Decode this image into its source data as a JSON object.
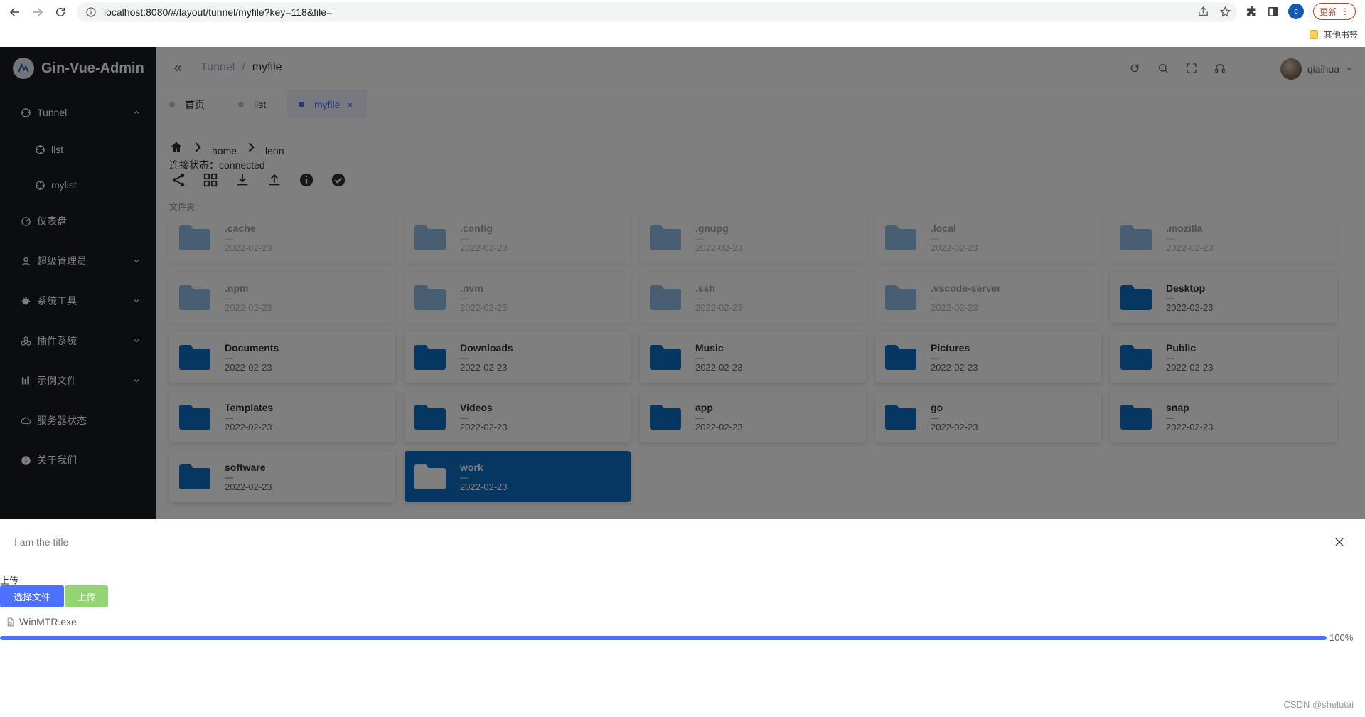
{
  "browser": {
    "url": "localhost:8080/#/layout/tunnel/myfile?key=118&file=",
    "profile_initial": "c",
    "update_label": "更新",
    "bookmark_other": "其他书签"
  },
  "sidebar": {
    "brand": "Gin-Vue-Admin",
    "items": [
      {
        "label": "Tunnel",
        "icon": "compass-icon"
      },
      {
        "label": "list",
        "icon": "compass-icon"
      },
      {
        "label": "mylist",
        "icon": "compass-icon"
      },
      {
        "label": "仪表盘",
        "icon": "dashboard-icon"
      },
      {
        "label": "超级管理员",
        "icon": "user-icon"
      },
      {
        "label": "系统工具",
        "icon": "gear-icon"
      },
      {
        "label": "插件系统",
        "icon": "plugin-icon"
      },
      {
        "label": "示例文件",
        "icon": "chart-icon"
      },
      {
        "label": "服务器状态",
        "icon": "cloud-icon"
      },
      {
        "label": "关于我们",
        "icon": "info-icon"
      }
    ]
  },
  "header": {
    "breadcrumb": [
      "Tunnel",
      "/",
      "myfile"
    ],
    "username": "qiaihua"
  },
  "tabs": [
    {
      "label": "首页",
      "active": false
    },
    {
      "label": "list",
      "active": false
    },
    {
      "label": "myfile",
      "active": true,
      "close": "×"
    }
  ],
  "filebrowser": {
    "path": [
      "home",
      "leon"
    ],
    "status": "连接状态：connected",
    "folders_label": "文件夹:",
    "folders": [
      {
        "name": ".cache",
        "size": "—",
        "date": "2022-02-23",
        "hidden": true
      },
      {
        "name": ".config",
        "size": "—",
        "date": "2022-02-23",
        "hidden": true
      },
      {
        "name": ".gnupg",
        "size": "—",
        "date": "2022-02-23",
        "hidden": true
      },
      {
        "name": ".local",
        "size": "—",
        "date": "2022-02-23",
        "hidden": true
      },
      {
        "name": ".mozilla",
        "size": "—",
        "date": "2022-02-23",
        "hidden": true
      },
      {
        "name": ".npm",
        "size": "—",
        "date": "2022-02-23",
        "hidden": true
      },
      {
        "name": ".nvm",
        "size": "—",
        "date": "2022-02-23",
        "hidden": true
      },
      {
        "name": ".ssh",
        "size": "—",
        "date": "2022-02-23",
        "hidden": true
      },
      {
        "name": ".vscode-server",
        "size": "—",
        "date": "2022-02-23",
        "hidden": true
      },
      {
        "name": "Desktop",
        "size": "—",
        "date": "2022-02-23",
        "hidden": false
      },
      {
        "name": "Documents",
        "size": "—",
        "date": "2022-02-23",
        "hidden": false
      },
      {
        "name": "Downloads",
        "size": "—",
        "date": "2022-02-23",
        "hidden": false
      },
      {
        "name": "Music",
        "size": "—",
        "date": "2022-02-23",
        "hidden": false
      },
      {
        "name": "Pictures",
        "size": "—",
        "date": "2022-02-23",
        "hidden": false
      },
      {
        "name": "Public",
        "size": "—",
        "date": "2022-02-23",
        "hidden": false
      },
      {
        "name": "Templates",
        "size": "—",
        "date": "2022-02-23",
        "hidden": false
      },
      {
        "name": "Videos",
        "size": "—",
        "date": "2022-02-23",
        "hidden": false
      },
      {
        "name": "app",
        "size": "—",
        "date": "2022-02-23",
        "hidden": false
      },
      {
        "name": "go",
        "size": "—",
        "date": "2022-02-23",
        "hidden": false
      },
      {
        "name": "snap",
        "size": "—",
        "date": "2022-02-23",
        "hidden": false
      },
      {
        "name": "software",
        "size": "—",
        "date": "2022-02-23",
        "hidden": false
      },
      {
        "name": "work",
        "size": "—",
        "date": "2022-02-23",
        "hidden": false,
        "selected": true
      }
    ]
  },
  "drawer": {
    "title": "I am the title",
    "upload_label": "上传",
    "select_button": "选择文件",
    "upload_button": "上传",
    "file_name": "WinMTR.exe",
    "progress_percent": 100,
    "progress_text": "100%"
  },
  "watermark": "CSDN @shelutai"
}
